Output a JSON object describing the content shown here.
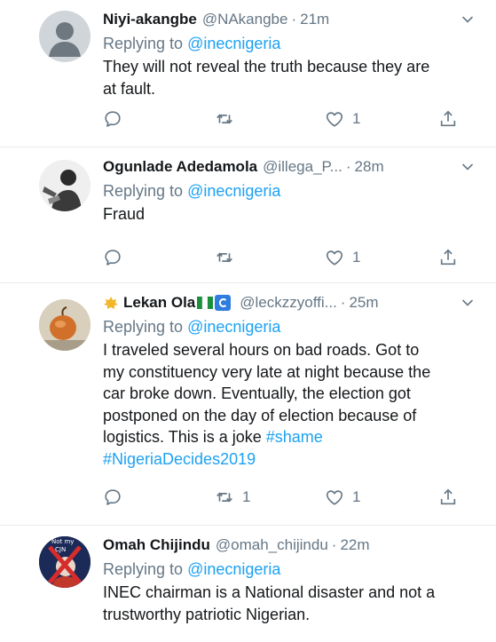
{
  "tweets": [
    {
      "name": "Niyi-akangbe",
      "handle": "@NAkangbe",
      "time": "21m",
      "replying_prefix": "Replying to",
      "replying_to": "@inecnigeria",
      "lines": [
        "They will not reveal the truth because they are",
        "at fault."
      ],
      "likes": "1",
      "retweets": ""
    },
    {
      "name": "Ogunlade Adedamola",
      "handle": "@illega_P...",
      "time": "28m",
      "replying_prefix": "Replying to",
      "replying_to": "@inecnigeria",
      "lines": [
        "Fraud"
      ],
      "likes": "1",
      "retweets": ""
    },
    {
      "name": "Lekan Ola",
      "handle": "@leckzzyoffi...",
      "time": "25m",
      "replying_prefix": "Replying to",
      "replying_to": "@inecnigeria",
      "lines": [
        "I traveled several hours on bad roads. Got to",
        "my constituency very late at night because the",
        "car broke down. Eventually, the election got",
        "postponed on the day of election because of",
        "logistics. This is a joke"
      ],
      "hashtag1": "#shame",
      "hashtag2": "#NigeriaDecides2019",
      "likes": "1",
      "retweets": "1"
    },
    {
      "name": "Omah Chijindu",
      "handle": "@omah_chijindu",
      "time": "22m",
      "replying_prefix": "Replying to",
      "replying_to": "@inecnigeria",
      "lines": [
        "INEC chairman is a National disaster and not a",
        "trustworthy patriotic Nigerian."
      ],
      "avatar_text_1": "Not my",
      "avatar_text_2": "CJN"
    }
  ],
  "colors": {
    "link": "#1da1f2",
    "muted": "#657786",
    "divider": "#e6ecf0"
  },
  "icons": [
    "reply-icon",
    "retweet-icon",
    "like-icon",
    "share-icon",
    "caret-down-icon"
  ]
}
